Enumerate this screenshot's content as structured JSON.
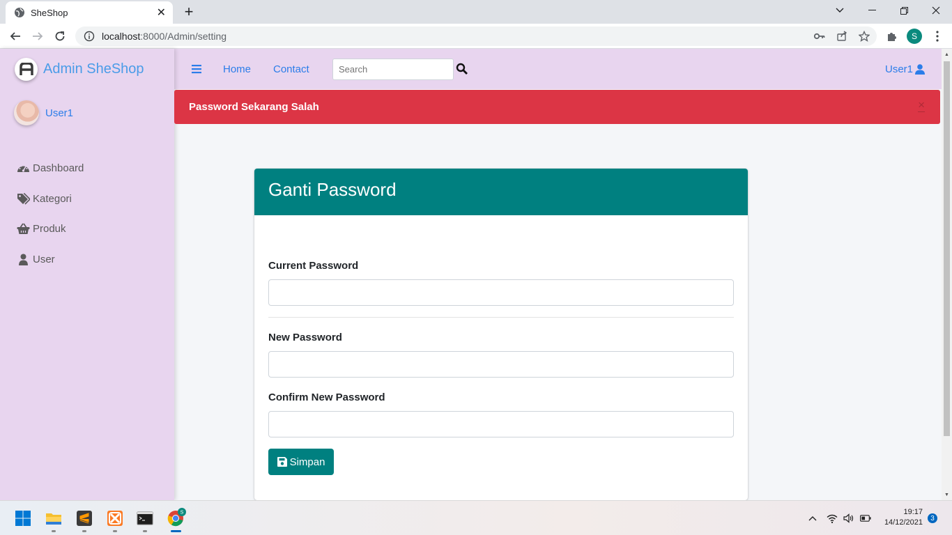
{
  "browser": {
    "tab_title": "SheShop",
    "url_host": "localhost",
    "url_rest": ":8000/Admin/setting",
    "profile_initial": "S"
  },
  "sidebar": {
    "brand": "Admin SheShop",
    "brand_logo": "A",
    "user": "User1",
    "items": [
      {
        "label": "Dashboard",
        "icon": "tachometer-icon"
      },
      {
        "label": "Kategori",
        "icon": "tags-icon"
      },
      {
        "label": "Produk",
        "icon": "basket-icon"
      },
      {
        "label": "User",
        "icon": "user-icon"
      }
    ]
  },
  "topnav": {
    "home": "Home",
    "contact": "Contact",
    "search_placeholder": "Search",
    "user": "User1"
  },
  "alert": {
    "message": "Password Sekarang Salah",
    "close": "×",
    "color": "#dc3545"
  },
  "card": {
    "title": "Ganti Password",
    "header_color": "#008080",
    "fields": [
      {
        "label": "Current Password",
        "value": ""
      },
      {
        "label": "New Password",
        "value": ""
      },
      {
        "label": "Confirm New Password",
        "value": ""
      }
    ],
    "save_label": "Simpan"
  },
  "taskbar": {
    "time": "19:17",
    "date": "14/12/2021",
    "notifications": "3",
    "chrome_badge": "S"
  },
  "colors": {
    "sidebar_bg": "#e8d5ef",
    "link": "#2b7de9",
    "accent": "#008080"
  }
}
